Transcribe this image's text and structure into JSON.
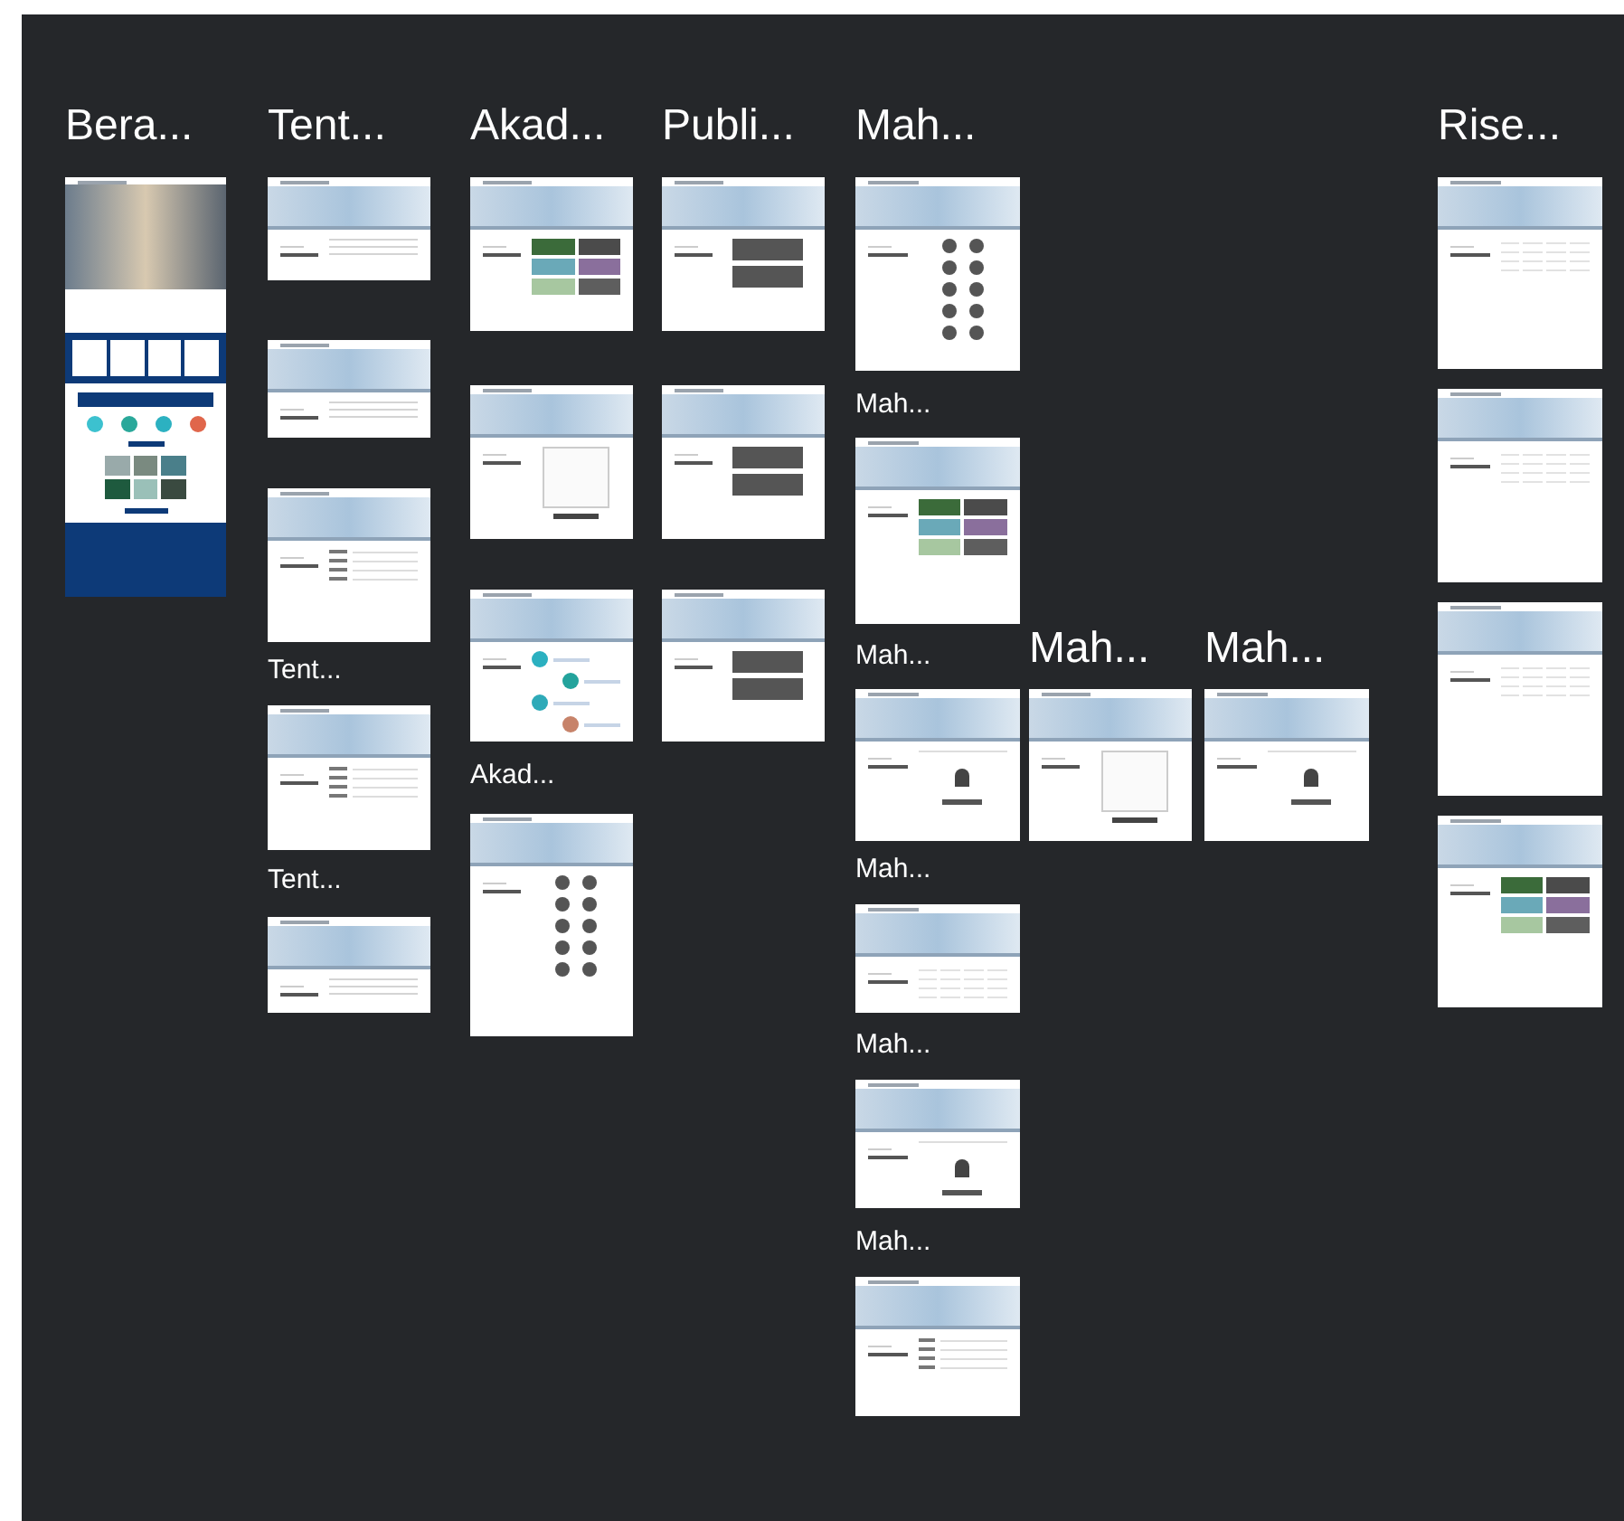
{
  "groups": [
    {
      "label": "Bera...",
      "frames": [
        {
          "kind": "home"
        }
      ]
    },
    {
      "label": "Tent...",
      "frames": [
        {
          "kind": "text"
        },
        {
          "kind": "text"
        },
        {
          "kind": "list"
        }
      ]
    },
    {
      "label": "Tent...",
      "frames": [
        {
          "kind": "list"
        }
      ]
    },
    {
      "label": "Tent...",
      "frames": [
        {
          "kind": "text"
        }
      ]
    },
    {
      "label": "Akad...",
      "frames": [
        {
          "kind": "gallery"
        },
        {
          "kind": "form"
        },
        {
          "kind": "icons"
        }
      ]
    },
    {
      "label": "Akad...",
      "frames": [
        {
          "kind": "dots"
        }
      ]
    },
    {
      "label": "Publi...",
      "frames": [
        {
          "kind": "blocks"
        },
        {
          "kind": "blocks"
        },
        {
          "kind": "blocks"
        }
      ]
    },
    {
      "label": "Mah...",
      "frames": [
        {
          "kind": "dots"
        }
      ]
    },
    {
      "label": "Mah...",
      "frames": [
        {
          "kind": "gallery"
        }
      ]
    },
    {
      "label": "Mah...",
      "frames": [
        {
          "kind": "profile"
        }
      ]
    },
    {
      "label": "Mah...",
      "frames": [
        {
          "kind": "form"
        }
      ]
    },
    {
      "label": "Mah...",
      "frames": [
        {
          "kind": "profile"
        }
      ]
    },
    {
      "label": "Mah...",
      "frames": [
        {
          "kind": "table"
        }
      ]
    },
    {
      "label": "Mah...",
      "frames": [
        {
          "kind": "profile"
        }
      ]
    },
    {
      "label": "Mah...",
      "frames": [
        {
          "kind": "list"
        }
      ]
    },
    {
      "label": "Rise...",
      "frames": [
        {
          "kind": "table"
        },
        {
          "kind": "table"
        },
        {
          "kind": "table"
        },
        {
          "kind": "gallery"
        }
      ]
    }
  ]
}
